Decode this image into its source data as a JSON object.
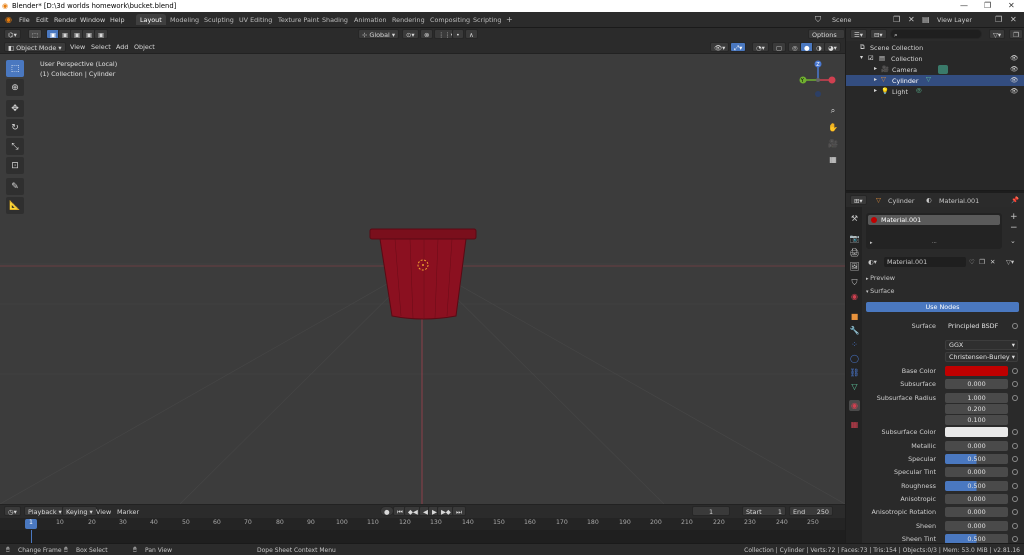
{
  "window": {
    "title": "Blender* [D:\\3d worlds homework\\bucket.blend]"
  },
  "menu": [
    "File",
    "Edit",
    "Render",
    "Window",
    "Help"
  ],
  "workspaces": [
    "Layout",
    "Modeling",
    "Sculpting",
    "UV Editing",
    "Texture Paint",
    "Shading",
    "Animation",
    "Rendering",
    "Compositing",
    "Scripting"
  ],
  "active_workspace": "Layout",
  "scene": {
    "scene_label": "Scene",
    "view_layer_label": "View Layer"
  },
  "viewport_header": {
    "mode": "Object Mode",
    "menus": [
      "View",
      "Select",
      "Add",
      "Object"
    ],
    "transform_orientation": "Global",
    "options": "Options"
  },
  "viewport": {
    "perspective": "User Perspective (Local)",
    "collection": "(1) Collection | Cylinder",
    "gizmo": {
      "x": "X",
      "y": "Y",
      "z": "Z"
    }
  },
  "timeline": {
    "menus": [
      "Playback",
      "Keying",
      "View",
      "Marker"
    ],
    "current_frame": "1",
    "start_label": "Start",
    "start": "1",
    "end_label": "End",
    "end": "250",
    "ruler": [
      "1",
      "10",
      "20",
      "30",
      "40",
      "50",
      "60",
      "70",
      "80",
      "90",
      "100",
      "110",
      "120",
      "130",
      "140",
      "150",
      "160",
      "170",
      "180",
      "190",
      "200",
      "210",
      "220",
      "230",
      "240",
      "250"
    ]
  },
  "outliner": {
    "root": "Scene Collection",
    "collection": "Collection",
    "items": [
      "Camera",
      "Cylinder",
      "Light"
    ]
  },
  "properties": {
    "object": "Cylinder",
    "material": "Material.001",
    "slot": "Material.001",
    "material_field": "Material.001",
    "panels": {
      "preview": "Preview",
      "surface": "Surface"
    },
    "use_nodes": "Use Nodes",
    "surface_label": "Surface",
    "surface_value": "Principled BSDF",
    "distribution": "GGX",
    "subsurface_method": "Christensen-Burley",
    "fields": [
      {
        "label": "Base Color",
        "value": "",
        "kind": "color",
        "color": "#c00000"
      },
      {
        "label": "Subsurface",
        "value": "0.000"
      },
      {
        "label": "Subsurface Radius",
        "value": "1.000"
      },
      {
        "label": "",
        "value": "0.200"
      },
      {
        "label": "",
        "value": "0.100"
      },
      {
        "label": "Subsurface Color",
        "value": "",
        "kind": "color",
        "color": "#e8e8e8"
      },
      {
        "label": "Metallic",
        "value": "0.000"
      },
      {
        "label": "Specular",
        "value": "0.500",
        "kind": "blue"
      },
      {
        "label": "Specular Tint",
        "value": "0.000"
      },
      {
        "label": "Roughness",
        "value": "0.500",
        "kind": "blue"
      },
      {
        "label": "Anisotropic",
        "value": "0.000"
      },
      {
        "label": "Anisotropic Rotation",
        "value": "0.000"
      },
      {
        "label": "Sheen",
        "value": "0.000"
      },
      {
        "label": "Sheen Tint",
        "value": "0.500",
        "kind": "blue"
      }
    ]
  },
  "status": {
    "change_frame": "Change Frame",
    "box_select": "Box Select",
    "pan_view": "Pan View",
    "context_menu": "Dope Sheet Context Menu",
    "info": "Collection | Cylinder | Verts:72 | Faces:73 | Tris:154 | Objects:0/3 | Mem: 53.0 MiB | v2.81.16"
  },
  "colors": {
    "accent": "#4a78c0",
    "bucket": "#8b1020",
    "base_color": "#c00000"
  }
}
